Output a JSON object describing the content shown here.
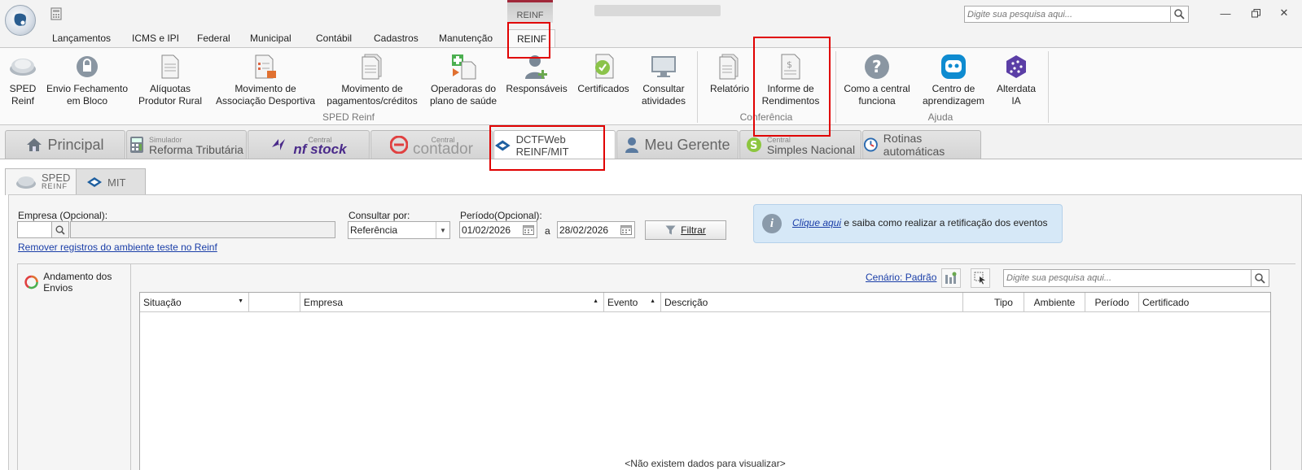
{
  "titlebar": {
    "context_tab": "REINF",
    "search_placeholder": "Digite sua pesquisa aqui..."
  },
  "menu": {
    "items": [
      "Lançamentos",
      "ICMS e IPI",
      "Federal",
      "Municipal",
      "Contábil",
      "Cadastros",
      "Manutenção",
      "REINF"
    ],
    "active": "REINF"
  },
  "ribbon": {
    "buttons": [
      {
        "label1": "SPED",
        "label2": "Reinf",
        "icon": "sped-disc-icon"
      },
      {
        "label1": "Envio Fechamento",
        "label2": "em Bloco",
        "icon": "lock-icon"
      },
      {
        "label1": "Alíquotas",
        "label2": "Produtor Rural",
        "icon": "document-icon"
      },
      {
        "label1": "Movimento de",
        "label2": "Associação Desportiva",
        "icon": "document-list-icon"
      },
      {
        "label1": "Movimento de",
        "label2": "pagamentos/créditos",
        "icon": "document-stack-icon"
      },
      {
        "label1": "Operadoras do",
        "label2": "plano de saúde",
        "icon": "health-plan-icon"
      },
      {
        "label1": "Responsáveis",
        "label2": "",
        "icon": "person-add-icon"
      },
      {
        "label1": "Certificados",
        "label2": "",
        "icon": "certificate-icon"
      },
      {
        "label1": "Consultar",
        "label2": "atividades",
        "icon": "monitor-icon"
      },
      {
        "label1": "Relatório",
        "label2": "",
        "icon": "report-icon"
      },
      {
        "label1": "Informe de",
        "label2": "Rendimentos",
        "icon": "income-report-icon"
      },
      {
        "label1": "Como a central",
        "label2": "funciona",
        "icon": "help-icon"
      },
      {
        "label1": "Centro de",
        "label2": "aprendizagem",
        "icon": "learning-center-icon"
      },
      {
        "label1": "Alterdata",
        "label2": "IA",
        "icon": "ai-icon"
      }
    ],
    "groups": [
      "SPED Reinf",
      "Conferência",
      "Ajuda"
    ]
  },
  "modules": {
    "principal": "Principal",
    "simulador_small": "Simulador",
    "simulador_big": "Reforma Tributária",
    "nfstock_small": "Central",
    "nfstock_big": "nf stock",
    "contador_small": "Central",
    "contador_big": "contador",
    "dctfweb": "DCTFWeb REINF/MIT",
    "meugerente": "Meu Gerente",
    "simples_small": "Central",
    "simples_big": "Simples Nacional",
    "rotinas": "Rotinas automáticas"
  },
  "subtabs": {
    "sped_top": "SPED",
    "sped_bottom": "REINF",
    "mit": "MIT"
  },
  "filters": {
    "empresa_label": "Empresa (Opcional):",
    "empresa_code": "",
    "empresa_name": "",
    "remover_link": "Remover registros do ambiente teste no Reinf",
    "consultar_label": "Consultar por:",
    "consultar_value": "Referência",
    "periodo_label": "Período(Opcional):",
    "data_inicio": "01/02/2026",
    "separador": "a",
    "data_fim": "28/02/2026",
    "filtrar_label": "Filtrar"
  },
  "info": {
    "link": "Clique aqui",
    "text": " e saiba como realizar a retificação dos eventos"
  },
  "envios": {
    "title": "Andamento dos Envios",
    "cenario": "Cenário: Padrão",
    "search_placeholder": "Digite sua pesquisa aqui...",
    "columns": [
      "Situação",
      "",
      "Empresa",
      "Evento",
      "Descrição",
      "Tipo",
      "Ambiente",
      "Período",
      "Certificado"
    ],
    "empty_message": "<Não existem dados para visualizar>"
  },
  "colors": {
    "highlight": "#e00000",
    "link": "#1a3ea8",
    "info_bg": "#d6e8f7",
    "context_accent": "#a0283a"
  }
}
